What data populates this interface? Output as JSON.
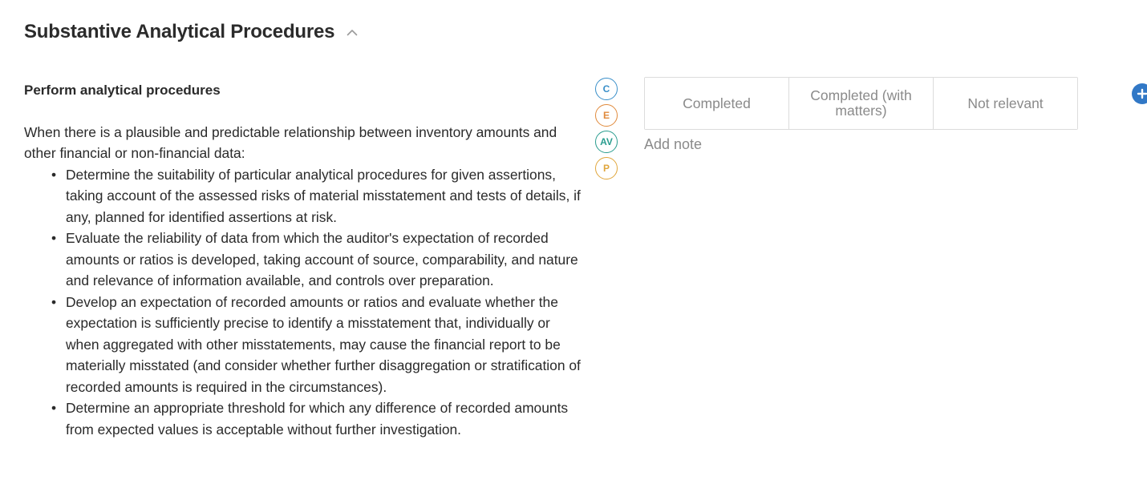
{
  "section": {
    "title": "Substantive Analytical Procedures"
  },
  "procedure": {
    "title": "Perform analytical procedures",
    "intro": "When there is a plausible and predictable relationship between inventory amounts and other financial or non-financial data:",
    "steps": [
      "Determine the suitability of particular analytical procedures for given assertions, taking account of the assessed risks of material misstatement and tests of details, if any, planned for identified assertions at risk.",
      "Evaluate the reliability of data from which the auditor's expectation of recorded amounts or ratios is developed, taking account of source, comparability, and nature and relevance of information available, and controls over preparation.",
      "Develop an expectation of recorded amounts or ratios and evaluate whether the expectation is sufficiently precise to identify a misstatement that, individually or when aggregated with other misstatements, may cause the financial report to be materially misstated (and consider whether further disaggregation or stratification of recorded amounts is required in the circumstances).",
      "Determine an appropriate threshold for which any difference of recorded amounts from expected values is acceptable without further investigation."
    ]
  },
  "assertions": [
    {
      "label": "C",
      "color": "#3a8fc9"
    },
    {
      "label": "E",
      "color": "#e08a3c"
    },
    {
      "label": "AV",
      "color": "#2a9d8f"
    },
    {
      "label": "P",
      "color": "#e0a63c"
    }
  ],
  "status_options": {
    "completed": "Completed",
    "completed_with_matters": "Completed (with matters)",
    "not_relevant": "Not relevant"
  },
  "note": {
    "add_label": "Add note"
  },
  "colors": {
    "accent": "#3178c6",
    "muted_text": "#8a8a8a",
    "border": "#dcdcdc"
  },
  "icons": {
    "collapse": "chevron-up-icon",
    "add": "plus-circle-icon"
  }
}
